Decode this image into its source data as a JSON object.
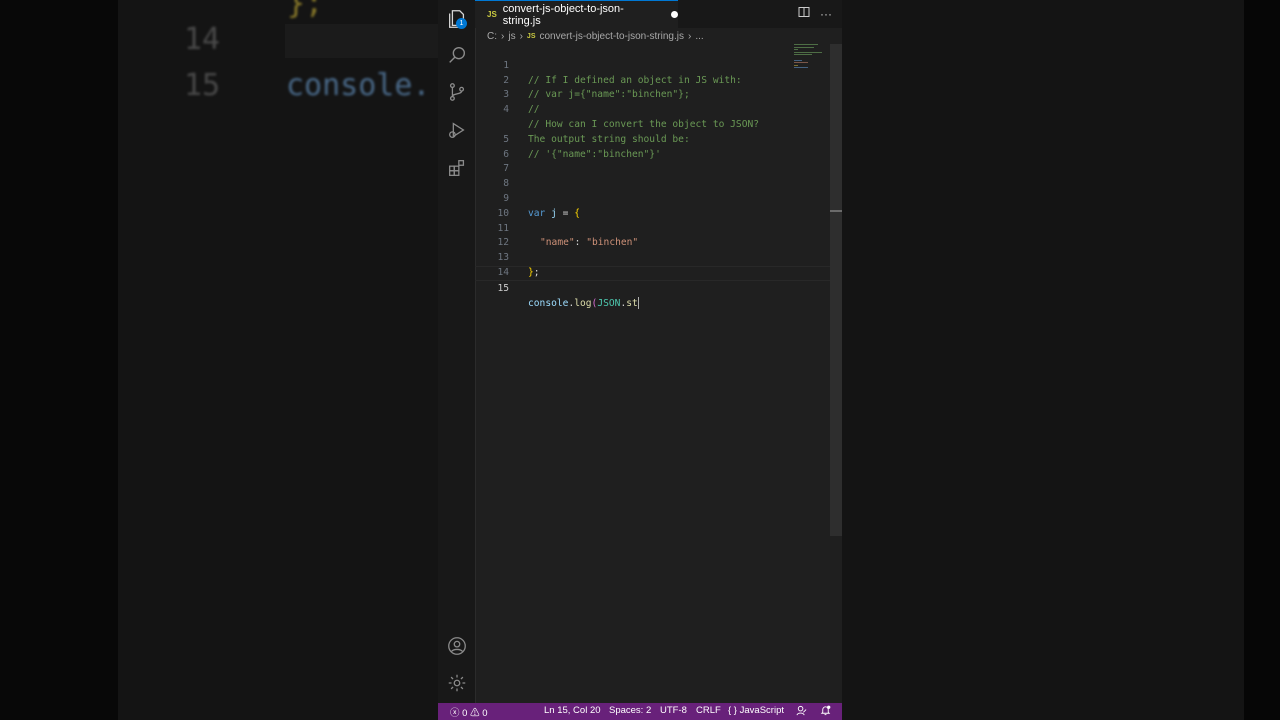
{
  "backdrop": {
    "line13": "};",
    "line14_num": "14",
    "line15_num": "15",
    "line15_code": "console."
  },
  "tab": {
    "lang_badge": "JS",
    "title": "convert-js-object-to-json-string.js"
  },
  "tab_actions": {
    "split_icon": "split-editor-icon",
    "more": "···"
  },
  "breadcrumb": {
    "drive": "C:",
    "sep": "›",
    "folder": "js",
    "file_badge": "JS",
    "file": "convert-js-object-to-json-string.js",
    "more": "..."
  },
  "activity": {
    "explorer_badge": "1"
  },
  "code": {
    "l1": {
      "num": "1",
      "text": "// If I defined an object in JS with:"
    },
    "l2": {
      "num": "2",
      "text": "// var j={\"name\":\"binchen\"};"
    },
    "l3": {
      "num": "3",
      "text": "//"
    },
    "l4": {
      "num": "4",
      "text": "// How can I convert the object to JSON?"
    },
    "l4b": {
      "num": "",
      "text": "The output string should be:"
    },
    "l5": {
      "num": "5",
      "text": "// '{\"name\":\"binchen\"}'"
    },
    "l6": {
      "num": "6"
    },
    "l7": {
      "num": "7"
    },
    "l8": {
      "num": "8"
    },
    "l9": {
      "num": "9",
      "kw": "var",
      "var": "j",
      "eq": " = ",
      "brace": "{"
    },
    "l10": {
      "num": "10"
    },
    "l11": {
      "num": "11",
      "key": "\"name\"",
      "colon": ": ",
      "value": "\"binchen\""
    },
    "l12": {
      "num": "12"
    },
    "l13": {
      "num": "13",
      "brace": "}",
      "semi": ";"
    },
    "l14": {
      "num": "14"
    },
    "l15": {
      "num": "15",
      "obj": "console",
      "dot": ".",
      "fn": "log",
      "paren": "(",
      "json": "JSON",
      "dot2": ".",
      "partial": "st"
    }
  },
  "status": {
    "errors": "0",
    "warnings": "0",
    "position": "Ln 15, Col 20",
    "spaces": "Spaces: 2",
    "encoding": "UTF-8",
    "eol": "CRLF",
    "braces": "{ }",
    "language": "JavaScript"
  }
}
